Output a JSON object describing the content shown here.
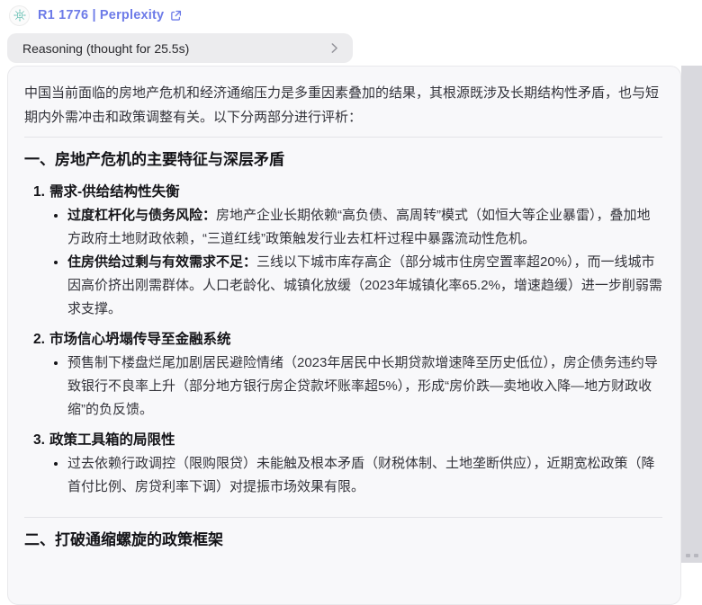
{
  "header": {
    "model_label": "R1 1776 | Perplexity",
    "avatar_icon": "model-avatar-mandala",
    "external_link_icon": "arrow-up-right-from-square"
  },
  "reasoning": {
    "label": "Reasoning (thought for 25.5s)",
    "chevron_icon": "chevron-right"
  },
  "colors": {
    "link_accent": "#6d7be8",
    "avatar_teal": "#53b8a9",
    "reasoning_bar_bg": "#ececee",
    "card_bg": "#f8f8fa",
    "scrollbar_track": "#d9d9de"
  },
  "content": {
    "intro": "中国当前面临的房地产危机和经济通缩压力是多重因素叠加的结果，其根源既涉及长期结构性矛盾，也与短期内外需冲击和政策调整有关。以下分两部分进行评析：",
    "section1": {
      "title": "一、房地产危机的主要特征与深层矛盾",
      "items": [
        {
          "num": "1.",
          "title": "需求-供给结构性失衡",
          "bullets": [
            {
              "lead": "过度杠杆化与债务风险：",
              "text": "房地产企业长期依赖“高负债、高周转”模式（如恒大等企业暴雷），叠加地方政府土地财政依赖，“三道红线”政策触发行业去杠杆过程中暴露流动性危机。"
            },
            {
              "lead": "住房供给过剩与有效需求不足：",
              "text": "三线以下城市库存高企（部分城市住房空置率超20%），而一线城市因高价挤出刚需群体。人口老龄化、城镇化放缓（2023年城镇化率65.2%，增速趋缓）进一步削弱需求支撑。"
            }
          ]
        },
        {
          "num": "2.",
          "title": "市场信心坍塌传导至金融系统",
          "bullets": [
            {
              "lead": "",
              "text": "预售制下楼盘烂尾加剧居民避险情绪（2023年居民中长期贷款增速降至历史低位），房企债务违约导致银行不良率上升（部分地方银行房企贷款坏账率超5%），形成“房价跌—卖地收入降—地方财政收缩”的负反馈。"
            }
          ]
        },
        {
          "num": "3.",
          "title": "政策工具箱的局限性",
          "bullets": [
            {
              "lead": "",
              "text": "过去依赖行政调控（限购限贷）未能触及根本矛盾（财税体制、土地垄断供应），近期宽松政策（降首付比例、房贷利率下调）对提振市场效果有限。"
            }
          ]
        }
      ]
    },
    "section2": {
      "title": "二、打破通缩螺旋的政策框架"
    }
  }
}
